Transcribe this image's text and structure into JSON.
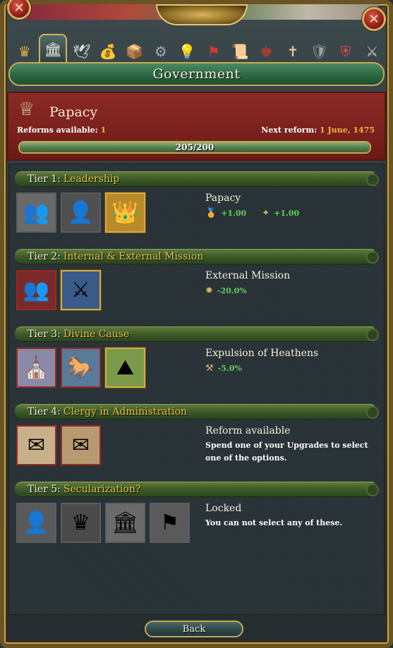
{
  "window": {
    "title": "Government",
    "close_label": "✕",
    "left_label": "✕"
  },
  "tabs": [
    {
      "icon": "crown-icon",
      "glyph": "♛",
      "color": "#e3b043"
    },
    {
      "icon": "government-building-icon",
      "glyph": "🏛",
      "color": "#f0ecdc"
    },
    {
      "icon": "dove-icon",
      "glyph": "🕊",
      "color": "#e8e8e8"
    },
    {
      "icon": "coins-icon",
      "glyph": "💰",
      "color": "#d9b35a"
    },
    {
      "icon": "crates-icon",
      "glyph": "📦",
      "color": "#b08a55"
    },
    {
      "icon": "gears-icon",
      "glyph": "⚙",
      "color": "#9ab0c0"
    },
    {
      "icon": "lightbulb-icon",
      "glyph": "💡",
      "color": "#f0e070"
    },
    {
      "icon": "flag-icon",
      "glyph": "⚑",
      "color": "#d03a2a"
    },
    {
      "icon": "scroll-icon",
      "glyph": "📜",
      "color": "#d9c9a0"
    },
    {
      "icon": "crown-red-icon",
      "glyph": "♚",
      "color": "#c0392b"
    },
    {
      "icon": "cross-icon",
      "glyph": "✝",
      "color": "#e3c88a"
    },
    {
      "icon": "cannon-icon",
      "glyph": "🛡",
      "color": "#a0a0a0"
    },
    {
      "icon": "heraldry-icon",
      "glyph": "⛨",
      "color": "#e04a4a"
    },
    {
      "icon": "crossed-swords-icon",
      "glyph": "⚔",
      "color": "#c8c8c8"
    }
  ],
  "header": {
    "government_name": "Papacy",
    "reforms_available_label": "Reforms available:",
    "reforms_available_value": "1",
    "next_reform_label": "Next reform:",
    "next_reform_value": "1 June, 1475",
    "progress_text": "205/200",
    "progress_fraction": 1.0
  },
  "tiers": [
    {
      "label": "Tier 1:",
      "name": "Leadership",
      "reforms": [
        {
          "name": "reform-clergy-council",
          "glyph": "👥",
          "bg": "#6a6a6a",
          "selected": false,
          "red": false
        },
        {
          "name": "reform-monks",
          "glyph": "👤",
          "bg": "#505050",
          "selected": false,
          "red": false
        },
        {
          "name": "reform-papacy",
          "glyph": "👑",
          "bg": "#b88a2a",
          "selected": true,
          "red": false
        }
      ],
      "info_title": "Papacy",
      "effects": [
        {
          "icon": "prestige-icon",
          "glyph": "🏅",
          "value": "+1.00"
        },
        {
          "icon": "papal-influence-icon",
          "glyph": "✦",
          "value": "+1.00"
        }
      ],
      "desc": ""
    },
    {
      "label": "Tier 2:",
      "name": "Internal & External Mission",
      "reforms": [
        {
          "name": "reform-internal-mission",
          "glyph": "👥",
          "bg": "#7a2a2a",
          "selected": false,
          "red": true
        },
        {
          "name": "reform-external-mission",
          "glyph": "⚔",
          "bg": "#3a5a8a",
          "selected": true,
          "red": false
        }
      ],
      "info_title": "External Mission",
      "effects": [
        {
          "icon": "aggressive-expansion-icon",
          "glyph": "✹",
          "value": "-20.0%"
        }
      ],
      "desc": ""
    },
    {
      "label": "Tier 3:",
      "name": "Divine Cause",
      "reforms": [
        {
          "name": "reform-church",
          "glyph": "⛪",
          "bg": "#8a8aa8",
          "selected": false,
          "red": true
        },
        {
          "name": "reform-crusader",
          "glyph": "🐎",
          "bg": "#5a7a9a",
          "selected": false,
          "red": true
        },
        {
          "name": "reform-expulsion-of-heathens",
          "glyph": "⛰",
          "bg": "#7a9a4a",
          "selected": true,
          "red": false
        }
      ],
      "info_title": "Expulsion of Heathens",
      "effects": [
        {
          "icon": "cost-icon",
          "glyph": "⚒",
          "value": "-5.0%"
        }
      ],
      "desc": ""
    },
    {
      "label": "Tier 4:",
      "name": "Clergy in Administration",
      "reforms": [
        {
          "name": "reform-letters",
          "glyph": "✉",
          "bg": "#c8b08a",
          "selected": false,
          "red": true
        },
        {
          "name": "reform-seal",
          "glyph": "✉",
          "bg": "#b89a70",
          "selected": false,
          "red": true
        }
      ],
      "info_title": "Reform available",
      "effects": [],
      "desc": "Spend one of your Upgrades to select one of the options."
    },
    {
      "label": "Tier 5:",
      "name": "Secularization?",
      "reforms": [
        {
          "name": "reform-noble",
          "glyph": "👤",
          "bg": "#5a5a5a",
          "selected": false,
          "red": false
        },
        {
          "name": "reform-crown",
          "glyph": "♛",
          "bg": "#4a4a4a",
          "selected": false,
          "red": false
        },
        {
          "name": "reform-parliament",
          "glyph": "🏛",
          "bg": "#6a6a6a",
          "selected": false,
          "red": false
        },
        {
          "name": "reform-revolution",
          "glyph": "⚑",
          "bg": "#5a5a5a",
          "selected": false,
          "red": false
        }
      ],
      "info_title": "Locked",
      "effects": [],
      "desc": "You can not select any of these."
    }
  ],
  "footer": {
    "back_label": "Back"
  }
}
